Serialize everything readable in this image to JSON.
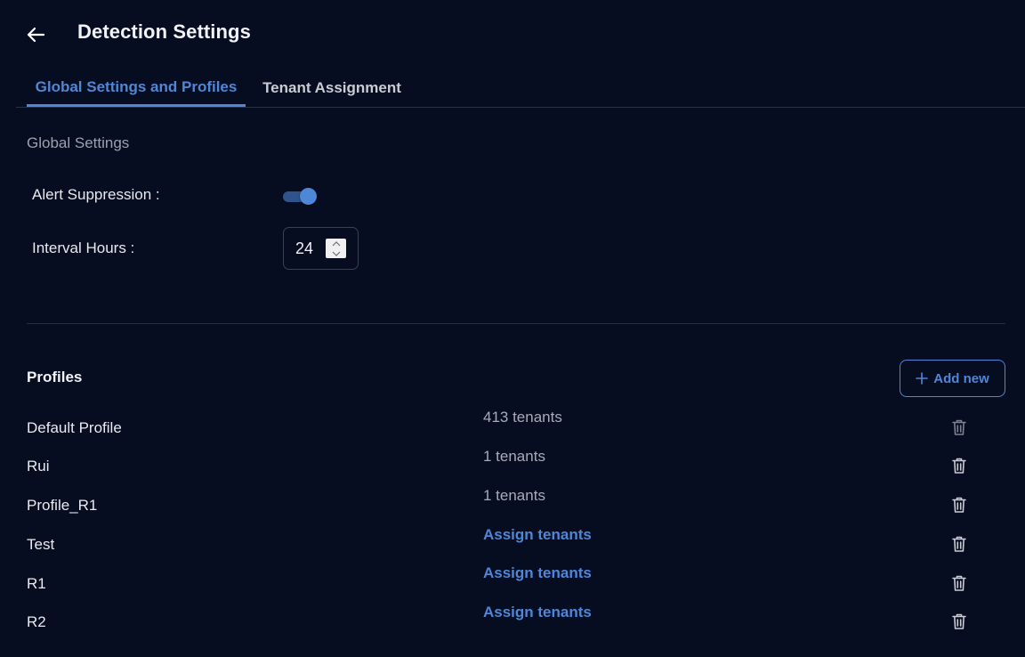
{
  "header": {
    "title": "Detection Settings",
    "back_icon": "arrow-left-icon"
  },
  "tabs": [
    {
      "label": "Global Settings and Profiles",
      "active": true
    },
    {
      "label": "Tenant Assignment",
      "active": false
    }
  ],
  "global_settings": {
    "section_label": "Global Settings",
    "alert_suppression": {
      "label": "Alert Suppression :",
      "enabled": true
    },
    "interval_hours": {
      "label": "Interval Hours :",
      "value": "24"
    }
  },
  "profiles": {
    "heading": "Profiles",
    "add_new_label": "Add new",
    "rows": [
      {
        "name": "Default Profile",
        "tenants": "413 tenants",
        "assigned": true
      },
      {
        "name": "Rui",
        "tenants": "1 tenants",
        "assigned": true
      },
      {
        "name": "Profile_R1",
        "tenants": "1 tenants",
        "assigned": true
      },
      {
        "name": "Test",
        "tenants": "Assign tenants",
        "assigned": false
      },
      {
        "name": "R1",
        "tenants": "Assign tenants",
        "assigned": false
      },
      {
        "name": "R2",
        "tenants": "Assign tenants",
        "assigned": false
      }
    ]
  },
  "colors": {
    "background": "#070d20",
    "accent": "#4e86d8",
    "muted_text": "#a6acb7"
  }
}
